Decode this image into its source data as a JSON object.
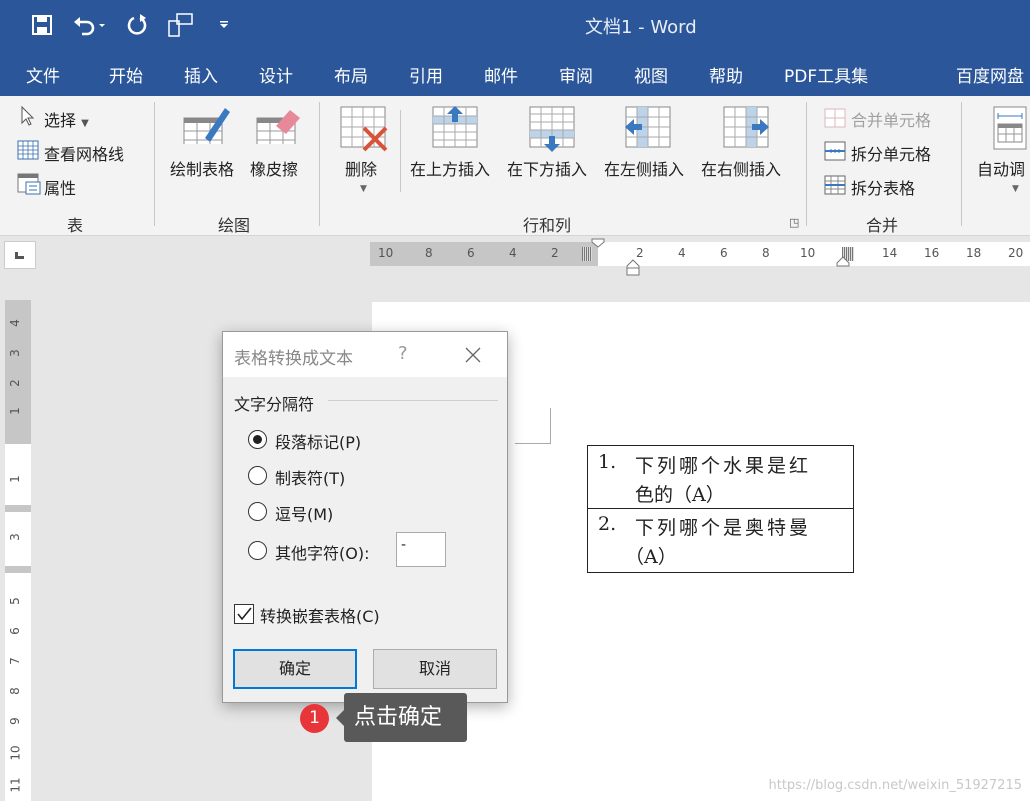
{
  "window": {
    "title": "文档1  -  Word"
  },
  "quick_access": {
    "icons": [
      "save-icon",
      "undo-icon",
      "redo-icon",
      "touch-mode-icon",
      "customize-icon"
    ]
  },
  "tabs": [
    {
      "label": "文件"
    },
    {
      "label": "开始"
    },
    {
      "label": "插入"
    },
    {
      "label": "设计"
    },
    {
      "label": "布局"
    },
    {
      "label": "引用"
    },
    {
      "label": "邮件"
    },
    {
      "label": "审阅"
    },
    {
      "label": "视图"
    },
    {
      "label": "帮助"
    },
    {
      "label": "PDF工具集"
    },
    {
      "label": "百度网盘"
    }
  ],
  "ribbon": {
    "table_group": {
      "label": "表",
      "select": "选择",
      "gridlines": "查看网格线",
      "properties": "属性"
    },
    "draw_group": {
      "label": "绘图",
      "draw_table": "绘制表格",
      "eraser": "橡皮擦"
    },
    "rows_cols_group": {
      "label": "行和列",
      "delete": "删除",
      "insert_above": "在上方插入",
      "insert_below": "在下方插入",
      "insert_left": "在左侧插入",
      "insert_right": "在右侧插入"
    },
    "merge_group": {
      "label": "合并",
      "merge_cells": "合并单元格",
      "split_cells": "拆分单元格",
      "split_table": "拆分表格"
    },
    "autofit": "自动调"
  },
  "ruler": {
    "h_left": [
      "10",
      "8",
      "6",
      "4",
      "2"
    ],
    "h_right": [
      "2",
      "4",
      "6",
      "8",
      "10",
      "14",
      "16",
      "18",
      "20"
    ],
    "v": [
      "4",
      "3",
      "2",
      "1",
      "1",
      "3",
      "5",
      "6",
      "7",
      "8",
      "9",
      "10",
      "11"
    ]
  },
  "document": {
    "rows": [
      {
        "num": "1.",
        "line1": "下列哪个水果是红",
        "line2": "色的（A）"
      },
      {
        "num": "2.",
        "line1": "下列哪个是奥特曼",
        "line2": "（A）"
      }
    ]
  },
  "dialog": {
    "title": "表格转换成文本",
    "help": "?",
    "section": "文字分隔符",
    "options": [
      {
        "label": "段落标记(P)",
        "selected": true
      },
      {
        "label": "制表符(T)",
        "selected": false
      },
      {
        "label": "逗号(M)",
        "selected": false
      },
      {
        "label": "其他字符(O):",
        "selected": false
      }
    ],
    "other_value": "-",
    "nested": {
      "label": "转换嵌套表格(C)",
      "checked": true
    },
    "ok": "确定",
    "cancel": "取消"
  },
  "annotation": {
    "step": "1",
    "text": "点击确定",
    "color": "#e8353a"
  },
  "watermark": "https://blog.csdn.net/weixin_51927215",
  "colors": {
    "brand": "#2b579a",
    "accent_blue": "#4a7ebb",
    "delete_red": "#d9533a"
  }
}
